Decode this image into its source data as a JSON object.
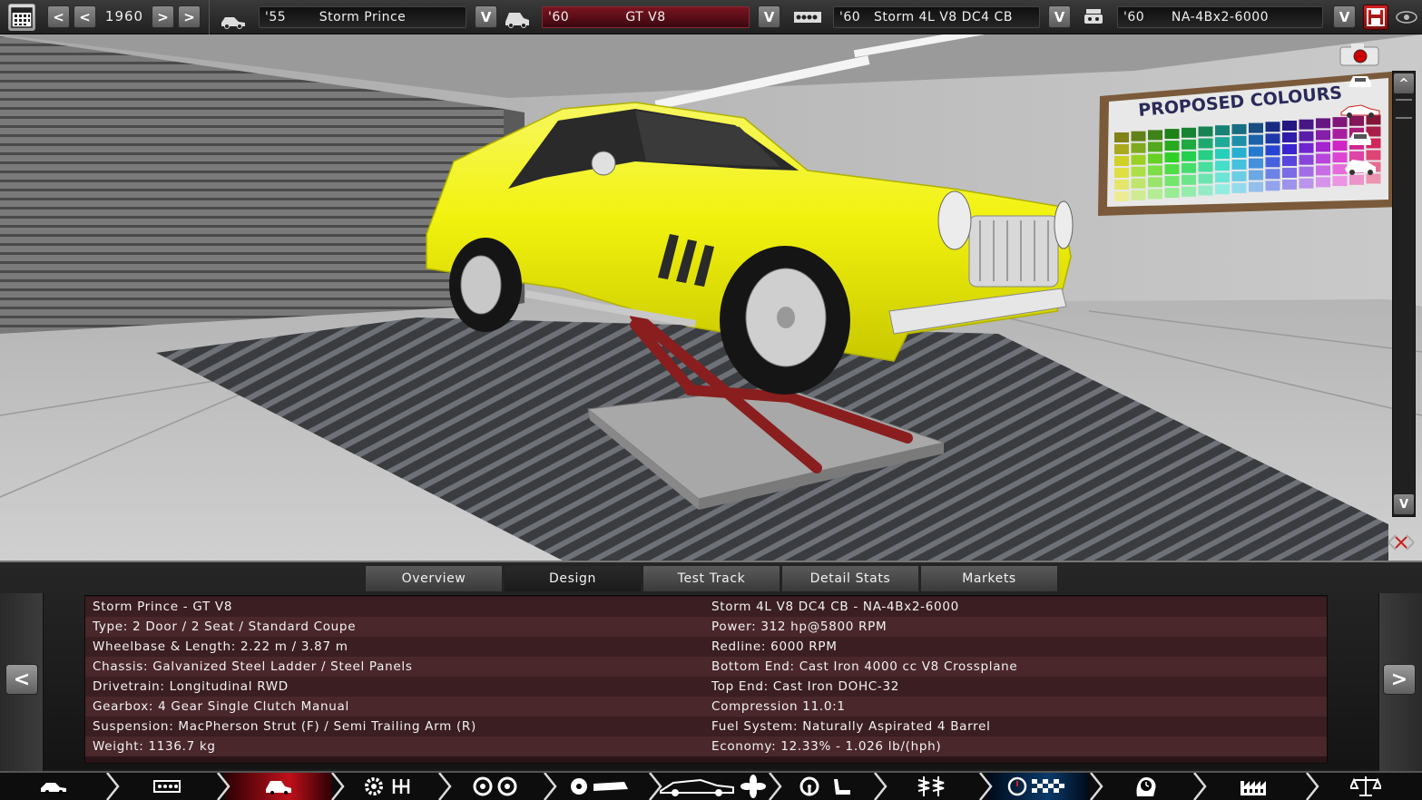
{
  "topbar": {
    "year": "1960",
    "model": {
      "year": "'55",
      "name": "Storm Prince"
    },
    "trim": {
      "year": "'60",
      "name": "GT V8"
    },
    "engine_family": {
      "year": "'60",
      "name": "Storm 4L V8 DC4 CB"
    },
    "engine_variant": {
      "year": "'60",
      "name": "NA-4Bx2-6000"
    },
    "prev_label": "<",
    "next_label": ">",
    "dropdown_label": "V"
  },
  "viewport": {
    "poster_text": "PROPOSED COLOURS",
    "scroll_up": "^",
    "scroll_down": "V"
  },
  "tabs": [
    "Overview",
    "Design",
    "Test Track",
    "Detail Stats",
    "Markets"
  ],
  "active_tab": "Design",
  "details": {
    "left": [
      "Storm Prince - GT V8",
      "Type: 2 Door / 2 Seat / Standard Coupe",
      "Wheelbase & Length: 2.22 m / 3.87 m",
      "Chassis: Galvanized Steel Ladder / Steel Panels",
      "Drivetrain: Longitudinal RWD",
      "Gearbox: 4 Gear Single Clutch Manual",
      "Suspension: MacPherson Strut (F) / Semi Trailing Arm (R)",
      "Weight: 1136.7 kg"
    ],
    "right": [
      "Storm 4L V8 DC4 CB - NA-4Bx2-6000",
      "Power: 312 hp@5800 RPM",
      "Redline: 6000 RPM",
      "Bottom End: Cast Iron 4000 cc V8 Crossplane",
      "Top End: Cast Iron DOHC-32",
      "Compression 11.0:1",
      "Fuel System: Naturally Aspirated 4 Barrel",
      "Economy: 12.33% - 1.026 lb/(hph)"
    ]
  },
  "side_arrows": {
    "left": "<",
    "right": ">"
  },
  "nav": {
    "items": [
      "car-model",
      "chassis",
      "car-body",
      "engine-gearbox",
      "suspension-wheels",
      "trim-aero",
      "interior-steering",
      "shocks-springs",
      "test-track",
      "engineer-time",
      "factory",
      "legal-balance"
    ],
    "active": "car-body",
    "active_secondary": "test-track"
  },
  "colors": {
    "car_yellow": "#f2f20e",
    "active_red": "#c0101a",
    "field_red": "#7a1420",
    "info_row_dark": "#3b1e22",
    "info_row_light": "#4a272b"
  }
}
